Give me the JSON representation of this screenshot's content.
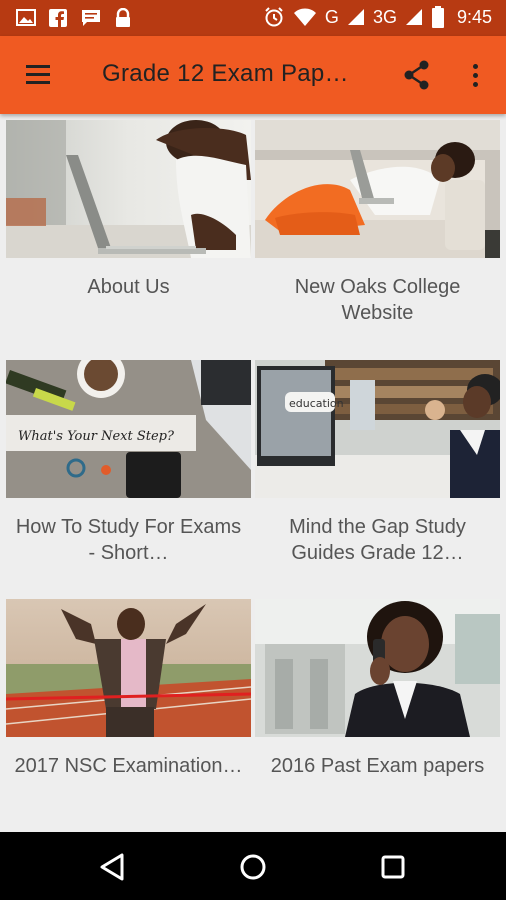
{
  "status_bar": {
    "time": "9:45",
    "network_g": "G",
    "network_3g": "3G",
    "icons": [
      "image-icon",
      "facebook-icon",
      "message-icon",
      "lock-icon",
      "alarm-icon",
      "wifi-icon",
      "signal-icon",
      "battery-icon"
    ]
  },
  "app_bar": {
    "title": "Grade 12 Exam Pap…",
    "color": "#f05a22"
  },
  "cards": [
    {
      "label": "About Us"
    },
    {
      "label": "New Oaks College Website"
    },
    {
      "label": "How To Study For Exams - Short…"
    },
    {
      "label": "Mind the Gap Study Guides Grade 12…"
    },
    {
      "label": "2017 NSC Examination…"
    },
    {
      "label": "2016 Past Exam papers"
    }
  ],
  "thumb_texts": {
    "next_step": "What's Your Next Step?",
    "education": "education"
  },
  "nav": {
    "icons": [
      "back-icon",
      "home-icon",
      "recents-icon"
    ]
  }
}
